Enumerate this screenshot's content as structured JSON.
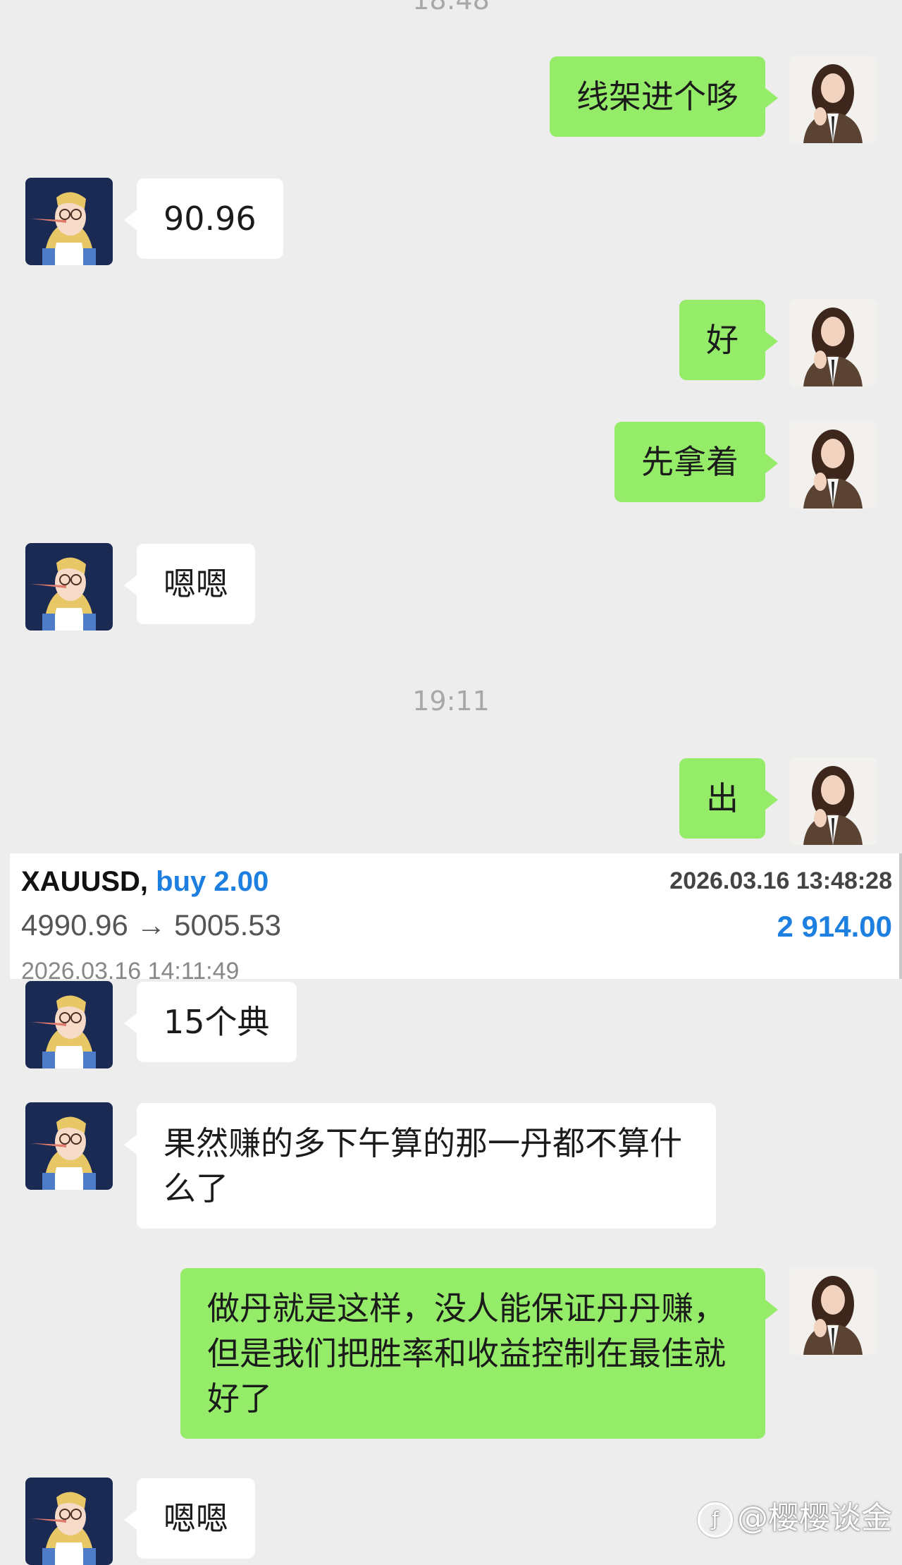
{
  "timestamps": [
    "18:48",
    "19:11"
  ],
  "messages": [
    {
      "side": "out",
      "text": "线架进个哆"
    },
    {
      "side": "in",
      "text": "90.96"
    },
    {
      "side": "out",
      "text": "好"
    },
    {
      "side": "out",
      "text": "先拿着"
    },
    {
      "side": "in",
      "text": "嗯嗯"
    },
    {
      "side": "out",
      "text": "出"
    },
    {
      "side": "in",
      "text": "15个典"
    },
    {
      "side": "in",
      "text": "果然赚的多下午算的那一丹都不算什么了"
    },
    {
      "side": "out",
      "text": "做丹就是这样，没人能保证丹丹赚，但是我们把胜率和收益控制在最佳就好了"
    },
    {
      "side": "in",
      "text": "嗯嗯"
    }
  ],
  "trade": {
    "symbol": "XAUUSD,",
    "side": "buy 2.00",
    "open_time": "2026.03.16 13:48:28",
    "prices": "4990.96 → 5005.53",
    "profit": "2 914.00",
    "close_time": "2026.03.16 14:11:49"
  },
  "watermark": "@樱樱谈金",
  "colors": {
    "background": "#ededed",
    "outgoing_bubble": "#95ec69",
    "incoming_bubble": "#ffffff",
    "profit": "#1d7fe0"
  }
}
